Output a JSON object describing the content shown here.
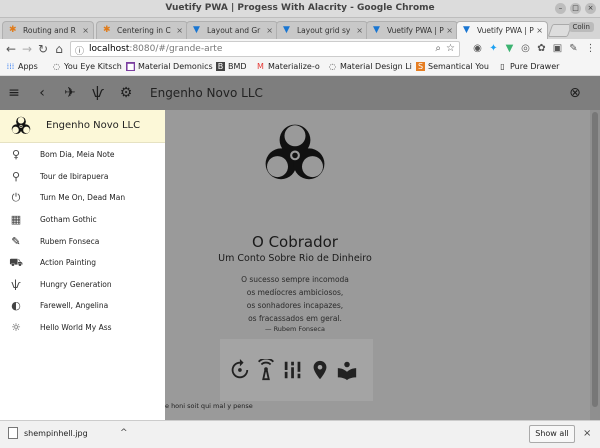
{
  "window": {
    "title": "Vuetify PWA | Progess With Alacrity - Google Chrome",
    "user_badge": "Colin"
  },
  "tabs": [
    {
      "label": "Routing and R",
      "icon": "asterisk-icon",
      "active": false
    },
    {
      "label": "Centering in C",
      "icon": "asterisk-icon",
      "active": false
    },
    {
      "label": "Layout and Gr",
      "icon": "vuetify-icon",
      "active": false
    },
    {
      "label": "Layout grid sy",
      "icon": "vuetify-icon",
      "active": false
    },
    {
      "label": "Vuetify PWA | P",
      "icon": "vuetify-icon",
      "active": false
    },
    {
      "label": "Vuetify PWA | P",
      "icon": "vuetify-icon",
      "active": true
    }
  ],
  "address": {
    "host": "localhost",
    "path": ":8080/#/grande-arte"
  },
  "bookmarks": [
    {
      "label": "Apps",
      "icon": "apps-grid-icon"
    },
    {
      "label": "You Eye Kitsch",
      "icon": "globe-icon"
    },
    {
      "label": "Material Demonics",
      "icon": "square-icon"
    },
    {
      "label": "BMD",
      "icon": "b-icon"
    },
    {
      "label": "Materialize-o",
      "icon": "m-icon"
    },
    {
      "label": "Material Design Li",
      "icon": "globe-icon"
    },
    {
      "label": "Semantical You",
      "icon": "s-icon"
    },
    {
      "label": "Pure Drawer",
      "icon": "page-icon"
    }
  ],
  "toolbar": {
    "title": "Engenho Novo LLC"
  },
  "drawer": {
    "header_title": "Engenho Novo LLC",
    "items": [
      {
        "label": "Bom Dia, Meia Note",
        "icon": "person-icon"
      },
      {
        "label": "Tour de Ibirapuera",
        "icon": "bicycle-icon"
      },
      {
        "label": "Turn Me On, Dead Man",
        "icon": "power-icon"
      },
      {
        "label": "Gotham Gothic",
        "icon": "grid-icon"
      },
      {
        "label": "Rubem Fonseca",
        "icon": "pen-icon"
      },
      {
        "label": "Action Painting",
        "icon": "truck-icon"
      },
      {
        "label": "Hungry Generation",
        "icon": "restaurant-icon"
      },
      {
        "label": "Farewell, Angelina",
        "icon": "contrast-icon"
      },
      {
        "label": "Hello World My Ass",
        "icon": "sunset-icon"
      }
    ]
  },
  "article": {
    "title": "O Cobrador",
    "subtitle": "Um Conto Sobre Rio de Dinheiro",
    "poem": [
      "O sucesso sempre incomoda",
      "os medíocres ambiciosos,",
      "os sonhadores incapazes,",
      "os fracassados em geral."
    ],
    "attribution": "— Rubem Fonseca",
    "footnote": "e honi soit qui mal y pense"
  },
  "downloads": {
    "filename": "shempinhell.jpg",
    "show_all": "Show all"
  }
}
